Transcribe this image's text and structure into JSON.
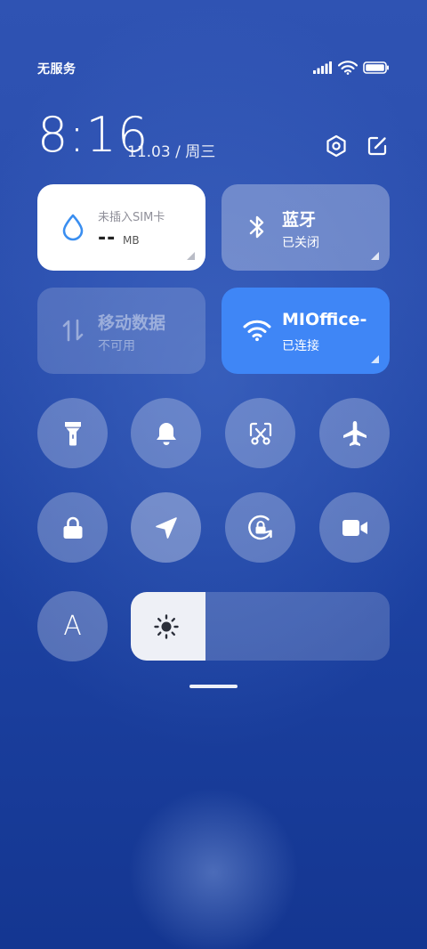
{
  "status_bar": {
    "carrier": "无服务",
    "icons": [
      "signal-icon",
      "wifi-icon",
      "battery-icon"
    ]
  },
  "header": {
    "time": "8:16",
    "date": "11.03 / 周三",
    "actions": [
      "settings-icon",
      "edit-icon"
    ]
  },
  "tiles": {
    "data_usage": {
      "label": "未插入SIM卡",
      "value": "--",
      "unit": "MB",
      "icon": "water-drop-icon",
      "accent": "#3a8ef0"
    },
    "bluetooth": {
      "title": "蓝牙",
      "status": "已关闭",
      "icon": "bluetooth-icon"
    },
    "mobile_data": {
      "title": "移动数据",
      "status": "不可用",
      "icon": "data-arrows-icon"
    },
    "wifi": {
      "title": "MIOffice-",
      "status": "已连接",
      "icon": "wifi-icon",
      "color": "#3f86f6"
    }
  },
  "toggles": [
    {
      "name": "flashlight",
      "icon": "flashlight-icon",
      "active": false
    },
    {
      "name": "ringer",
      "icon": "bell-icon",
      "active": false
    },
    {
      "name": "screenshot",
      "icon": "scissors-icon",
      "active": false
    },
    {
      "name": "airplane-mode",
      "icon": "airplane-icon",
      "active": false
    },
    {
      "name": "lock-screen",
      "icon": "lock-icon",
      "active": false
    },
    {
      "name": "location",
      "icon": "location-arrow-icon",
      "active": true
    },
    {
      "name": "auto-rotate",
      "icon": "rotation-lock-icon",
      "active": false
    },
    {
      "name": "screen-record",
      "icon": "video-camera-icon",
      "active": false
    }
  ],
  "auto_brightness": {
    "label": "A"
  },
  "brightness": {
    "level": 0.29,
    "icon": "sun-icon"
  }
}
